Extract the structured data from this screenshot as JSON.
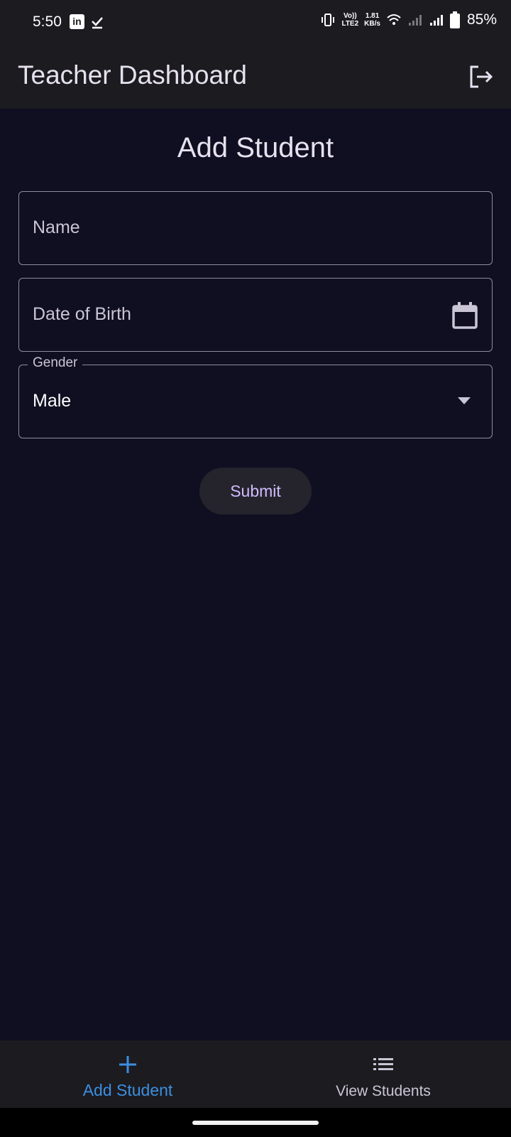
{
  "status_bar": {
    "time": "5:50",
    "network_line1": "Vo))",
    "network_line2": "LTE2",
    "speed_value": "1.81",
    "speed_unit": "KB/s",
    "battery": "85%"
  },
  "app_bar": {
    "title": "Teacher Dashboard",
    "logout_icon": "logout-icon"
  },
  "form": {
    "heading": "Add Student",
    "name_placeholder": "Name",
    "dob_placeholder": "Date of Birth",
    "gender_label": "Gender",
    "gender_value": "Male",
    "submit_label": "Submit"
  },
  "bottom_nav": {
    "items": [
      {
        "label": "Add Student",
        "icon": "plus-icon",
        "active": true
      },
      {
        "label": "View Students",
        "icon": "list-icon",
        "active": false
      }
    ]
  },
  "colors": {
    "background": "#100e21",
    "surface": "#1c1b20",
    "accent": "#3b8fe0",
    "button_text": "#cfbcff"
  }
}
